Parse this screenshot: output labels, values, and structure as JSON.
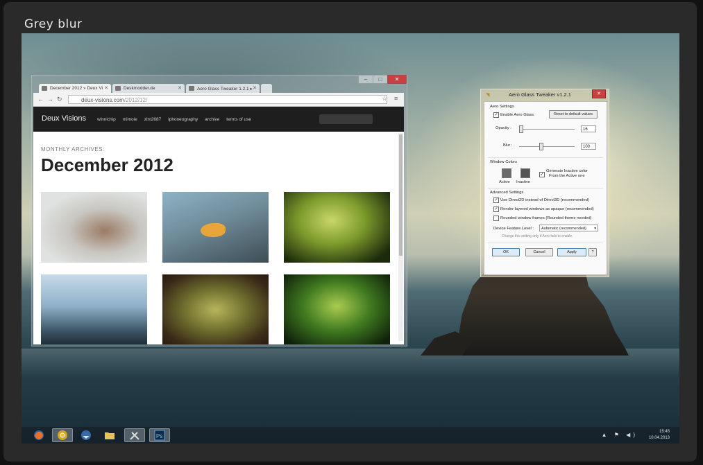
{
  "frame": {
    "title": "Grey blur"
  },
  "browser": {
    "tabs": [
      {
        "label": "December 2012 » Deux Vi",
        "active": true
      },
      {
        "label": "Deskmodder.de",
        "active": false
      },
      {
        "label": "Aero Glass Tweaker 1.2.1 ▸",
        "active": false
      }
    ],
    "url_host": "deux-visions.com",
    "url_path": "/2012/12/",
    "site": {
      "logo": "Deux Visions",
      "nav": [
        "winnichip",
        "mimoie",
        "zim2687",
        "iphoneography",
        "archive",
        "terms of use"
      ],
      "archive_label": "MONTHLY ARCHIVES:",
      "archive_title": "December 2012"
    }
  },
  "dialog": {
    "title": "Aero Glass Tweaker v1.2.1",
    "aero_settings": "Aero Settings",
    "enable_label": "Enable Aero Glass",
    "reset_label": "Reset to default values",
    "opacity_label": "Opacity :",
    "opacity_value": "16",
    "opacity_level": 0.03,
    "blur_label": "Blur :",
    "blur_value": "100",
    "blur_level": 0.39,
    "window_colors": "Window Colors",
    "active_label": "Active",
    "inactive_label": "Inactive",
    "generate_label_1": "Generate Inactive color",
    "generate_label_2": "From the Active one",
    "advanced_settings": "Advanced Settings",
    "adv_1": "Use Direct2D instead of Direct3D (recommended)",
    "adv_2": "Render layered windows as opaque (recommended)",
    "adv_3": "Rounded window frames (Rounded theme needed)",
    "device_level_label": "Device Feature Level :",
    "device_level_value": "Automatic (recommended)",
    "hint": "Change this setting only if Aero fails to enable.",
    "ok": "OK",
    "cancel": "Cancel",
    "apply": "Apply",
    "help": "?"
  },
  "taskbar": {
    "time": "15:45",
    "date": "10.04.2013",
    "apps": [
      "firefox-icon",
      "chrome-icon",
      "thunderbird-icon",
      "folder-icon",
      "tools-icon",
      "photoshop-icon"
    ]
  },
  "colors": {
    "frame": "#2a2a2a",
    "close_red": "#c94040",
    "site_header": "#1e1e1e"
  }
}
